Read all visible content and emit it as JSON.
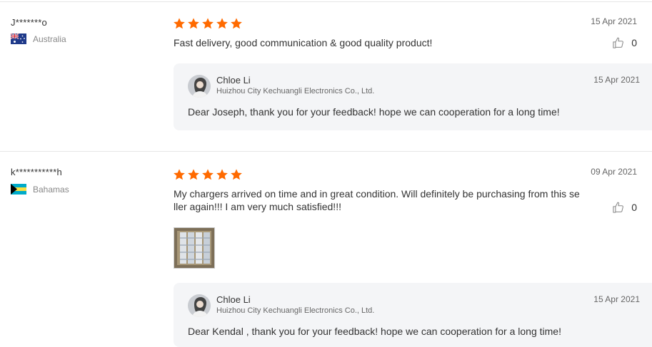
{
  "reviews": [
    {
      "user": "J*******o",
      "country": "Australia",
      "rating": 5,
      "date": "15 Apr 2021",
      "text": "Fast delivery, good communication & good quality product!",
      "helpful_count": "0",
      "reply": {
        "name": "Chloe Li",
        "company": "Huizhou City Kechuangli Electronics Co., Ltd.",
        "date": "15 Apr 2021",
        "text": "Dear Joseph, thank you for your feedback! hope we can cooperation for a long time!"
      }
    },
    {
      "user": "k***********h",
      "country": "Bahamas",
      "rating": 5,
      "date": "09 Apr 2021",
      "text": "My chargers arrived on time and in great condition. Will definitely be purchasing from this se ller again!!! I am very much satisfied!!!",
      "helpful_count": "0",
      "reply": {
        "name": "Chloe Li",
        "company": "Huizhou City Kechuangli Electronics Co., Ltd.",
        "date": "15 Apr 2021",
        "text": "Dear Kendal , thank you for your feedback! hope we can cooperation for a long time!"
      }
    }
  ],
  "icons": {
    "star": "star-icon",
    "thumb": "thumbs-up-icon",
    "flag_au": "australia-flag-icon",
    "flag_bs": "bahamas-flag-icon"
  },
  "colors": {
    "star": "#ff6a00",
    "reply_bg": "#f4f5f7",
    "separator": "#e6e6e6"
  }
}
